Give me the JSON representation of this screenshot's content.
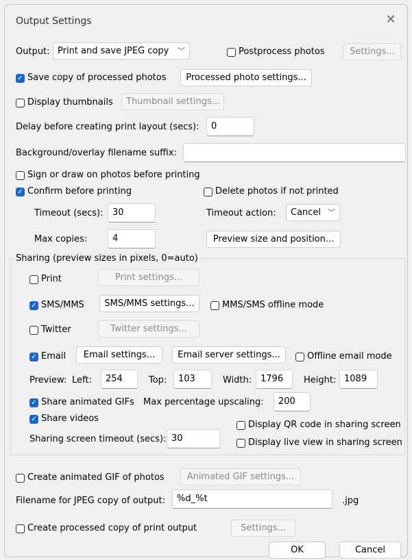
{
  "window": {
    "title": "Output Settings"
  },
  "output": {
    "label": "Output:",
    "selected": "Print and save JPEG copy",
    "postprocess_label": "Postprocess photos",
    "settings_label": "Settings..."
  },
  "save_copy": {
    "label": "Save copy of processed photos",
    "button": "Processed photo settings..."
  },
  "thumbnails": {
    "label": "Display thumbnails",
    "button": "Thumbnail settings..."
  },
  "delay": {
    "label": "Delay before creating print layout (secs):",
    "value": "0"
  },
  "suffix": {
    "label": "Background/overlay filename suffix:",
    "value": ""
  },
  "sign": {
    "label": "Sign or draw on photos before printing"
  },
  "confirm": {
    "label": "Confirm before printing",
    "delete_label": "Delete photos if not printed",
    "timeout_label": "Timeout (secs):",
    "timeout_value": "30",
    "action_label": "Timeout action:",
    "action_value": "Cancel",
    "max_label": "Max copies:",
    "max_value": "4",
    "preview_button": "Preview size and position..."
  },
  "sharing": {
    "group_label": "Sharing (preview sizes in pixels, 0=auto)",
    "print_label": "Print",
    "print_button": "Print settings...",
    "sms_label": "SMS/MMS",
    "sms_button": "SMS/MMS settings...",
    "sms_offline_label": "MMS/SMS offline mode",
    "twitter_label": "Twitter",
    "twitter_button": "Twitter settings...",
    "email_label": "Email",
    "email_button": "Email settings...",
    "email_server_button": "Email server settings...",
    "email_offline_label": "Offline email mode",
    "preview_label": "Preview:",
    "left_label": "Left:",
    "left_value": "254",
    "top_label": "Top:",
    "top_value": "103",
    "width_label": "Width:",
    "width_value": "1796",
    "height_label": "Height:",
    "height_value": "1089",
    "gifs_label": "Share animated GIFs",
    "upscale_label": "Max percentage upscaling:",
    "upscale_value": "200",
    "videos_label": "Share videos",
    "qr_label": "Display QR code in sharing screen",
    "timeout_label": "Sharing screen timeout (secs):",
    "timeout_value": "30",
    "liveview_label": "Display live view in sharing screen"
  },
  "gif": {
    "label": "Create animated GIF of photos",
    "button": "Animated GIF settings..."
  },
  "filename": {
    "label": "Filename for JPEG copy of output:",
    "value": "%d_%t",
    "ext": ".jpg"
  },
  "processed_copy": {
    "label": "Create processed copy of print output",
    "button": "Settings..."
  },
  "footer": {
    "ok": "OK",
    "cancel": "Cancel"
  },
  "colors": {
    "accent": "#1967c7",
    "background": "#f0f0f0"
  }
}
